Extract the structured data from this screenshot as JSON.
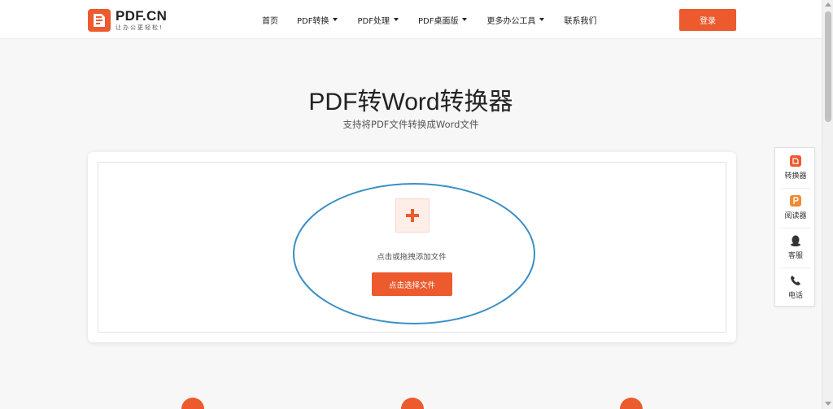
{
  "header": {
    "logo_title": "PDF.CN",
    "logo_slogan": "让办公更轻松!",
    "nav": [
      {
        "label": "首页",
        "has_dropdown": false
      },
      {
        "label": "PDF转换",
        "has_dropdown": true
      },
      {
        "label": "PDF处理",
        "has_dropdown": true
      },
      {
        "label": "PDF桌面版",
        "has_dropdown": true
      },
      {
        "label": "更多办公工具",
        "has_dropdown": true
      },
      {
        "label": "联系我们",
        "has_dropdown": false
      }
    ],
    "login_label": "登录"
  },
  "hero": {
    "title": "PDF转Word转换器",
    "subtitle": "支持将PDF文件转换成Word文件"
  },
  "upload": {
    "hint": "点击或拖拽添加文件",
    "button_label": "点击选择文件"
  },
  "side_panel": [
    {
      "icon": "pdf-converter-icon",
      "label": "转换器"
    },
    {
      "icon": "pdf-reader-icon",
      "label": "阅读器"
    },
    {
      "icon": "qq-icon",
      "label": "客服"
    },
    {
      "icon": "phone-icon",
      "label": "电话"
    }
  ],
  "colors": {
    "brand": "#ec5a2e",
    "annotation": "#3a8fc4"
  }
}
